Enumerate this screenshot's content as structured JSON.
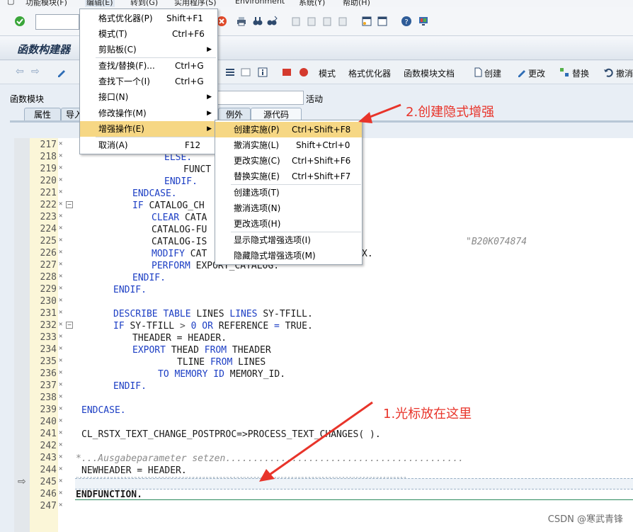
{
  "menubar": {
    "items": [
      "功能模块(F)",
      "编辑(E)",
      "转到(G)",
      "实用程序(S)",
      "Environment",
      "系统(Y)",
      "帮助(H)"
    ]
  },
  "title": "函数构建器",
  "app_toolbar": {
    "mode": "模式",
    "pretty_printer": "格式优化器",
    "fm_doc": "函数模块文档",
    "create": "创建",
    "change": "更改",
    "replace": "替换",
    "undo": "撤消"
  },
  "header": {
    "fm_label": "函数模块",
    "status": "活动"
  },
  "tabs": [
    "属性",
    "导入",
    "例外",
    "源代码"
  ],
  "edit_menu": {
    "items": [
      {
        "label": "格式优化器(P)",
        "shortcut": "Shift+F1"
      },
      {
        "label": "模式(T)",
        "shortcut": "Ctrl+F6"
      },
      {
        "label": "剪贴板(C)",
        "shortcut": ""
      },
      {
        "label": "查找/替换(F)...",
        "shortcut": "Ctrl+G"
      },
      {
        "label": "查找下一个(I)",
        "shortcut": "Ctrl+G"
      },
      {
        "label": "接口(N)",
        "shortcut": ""
      },
      {
        "label": "修改操作(M)",
        "shortcut": ""
      },
      {
        "label": "增强操作(E)",
        "shortcut": ""
      },
      {
        "label": "取消(A)",
        "shortcut": "F12"
      }
    ]
  },
  "enh_menu": {
    "items": [
      {
        "label": "创建实施(P)",
        "shortcut": "Ctrl+Shift+F8"
      },
      {
        "label": "撤消实施(L)",
        "shortcut": "Shift+Ctrl+0"
      },
      {
        "label": "更改实施(C)",
        "shortcut": "Ctrl+Shift+F6"
      },
      {
        "label": "替换实施(E)",
        "shortcut": "Ctrl+Shift+F7"
      },
      {
        "label": "创建选项(T)",
        "shortcut": ""
      },
      {
        "label": "撤消选项(N)",
        "shortcut": ""
      },
      {
        "label": "更改选项(H)",
        "shortcut": ""
      },
      {
        "label": "显示隐式增强选项(I)",
        "shortcut": ""
      },
      {
        "label": "隐藏隐式增强选项(M)",
        "shortcut": ""
      }
    ]
  },
  "code": {
    "line_numbers": [
      "217",
      "218",
      "219",
      "220",
      "221",
      "222",
      "223",
      "224",
      "225",
      "226",
      "227",
      "228",
      "229",
      "230",
      "231",
      "232",
      "233",
      "234",
      "235",
      "236",
      "237",
      "238",
      "239",
      "240",
      "241",
      "242",
      "243",
      "244",
      "245",
      "246",
      "247"
    ],
    "l218_a": "ELSE.",
    "l219_a": "FUNCT",
    "l220_a": "ENDIF.",
    "l221_a": "ENDCASE.",
    "l222_a": "IF",
    "l222_b": " CATALOG_CH",
    "l223_a": "CLEAR",
    "l223_b": " CATA",
    "l224_a": "CATALOG-FU",
    "l225_a": "CATALOG-IS",
    "l226_a": "MODIFY",
    "l226_b": " CAT",
    "l226_c": "X.",
    "l227_a": "PERFORM",
    "l227_b": " EXPORT_CATALOG.",
    "l228_a": "ENDIF.",
    "l229_a": "ENDIF.",
    "comment_right": "\"B20K074874",
    "l231_a": "DESCRIBE TABLE",
    "l231_b": " LINES ",
    "l231_c": "LINES",
    "l231_d": " SY-TFILL.",
    "l232_a": "IF",
    "l232_b": " SY-TFILL ",
    "l232_c": ">",
    "l232_d": " 0 ",
    "l232_e": "OR",
    "l232_f": " REFERENCE ",
    "l232_g": "=",
    "l232_h": " TRUE.",
    "l233_a": "THEADER",
    "l233_b": " = HEADER.",
    "l234_a": "EXPORT",
    "l234_b": " THEAD ",
    "l234_c": "FROM",
    "l234_d": " THEADER",
    "l235_a": "TLINE ",
    "l235_b": "FROM",
    "l235_c": " LINES",
    "l236_a": "TO MEMORY ID",
    "l236_b": " MEMORY_ID.",
    "l237_a": "ENDIF.",
    "l239_a": "ENDCASE.",
    "l241_a": "CL_RSTX_TEXT_CHANGE_POSTPROC=>PROCESS_TEXT_CHANGES( ).",
    "l243_a": "*...Ausgabeparameter setzen...........................................",
    "l244_a": "NEWHEADER = HEADER.",
    "l245_a": "\"\"\"\"\"\"\"\"\"\"\"\"\"\"\"\"\"\"\"\"\"\"\"\"\"\"\"\"\"\"\"\"\"\"\"\"\"\"\"\"\"\"\"\"\"\"\"\"\"\"\"\"\"\"\"\"\"\"\"\"\"\"\"\"\"\"\"\"\"\"\"\"\"\"\"\"\"\"\"\"\"\"\"\"\"\"\"\"\"\"\"\"\"\"\"\"\"",
    "l246_a": "ENDFUNCTION."
  },
  "annotations": {
    "step1": "1.光标放在这里",
    "step2": "2.创建隐式增强"
  },
  "watermark": "CSDN @寒武青锋",
  "colors": {
    "keyword": "#1c3ec4",
    "menu_highlight": "#f6d784",
    "annotation": "#e8342a"
  }
}
